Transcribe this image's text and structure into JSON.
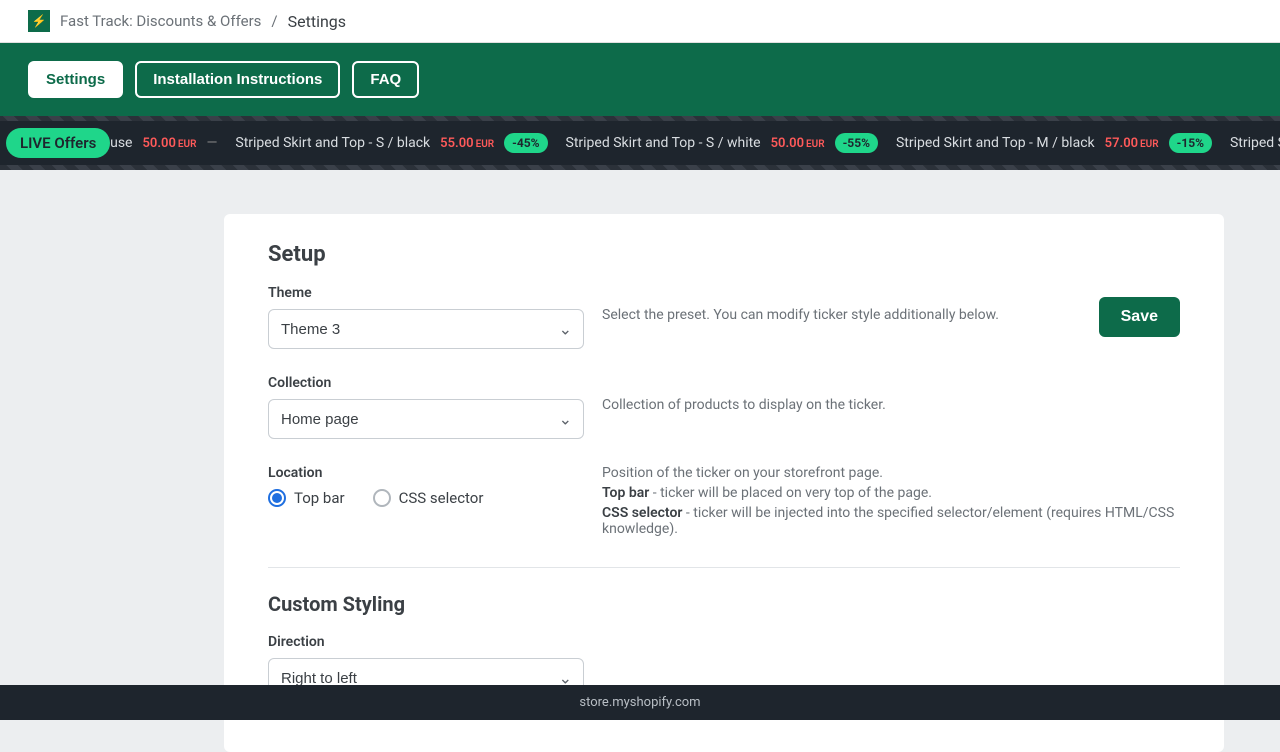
{
  "breadcrumb": {
    "app": "Fast Track: Discounts & Offers",
    "sep": "/",
    "current": "Settings"
  },
  "tabs": {
    "settings": "Settings",
    "install": "Installation Instructions",
    "faq": "FAQ"
  },
  "ticker": {
    "live": "LIVE Offers",
    "items": [
      {
        "name": "Blouse",
        "price": "50.00",
        "cur": "EUR",
        "discount": ""
      },
      {
        "name": "Striped Skirt and Top - S / black",
        "price": "55.00",
        "cur": "EUR",
        "discount": "-45%"
      },
      {
        "name": "Striped Skirt and Top - S / white",
        "price": "50.00",
        "cur": "EUR",
        "discount": "-55%"
      },
      {
        "name": "Striped Skirt and Top - M / black",
        "price": "57.00",
        "cur": "EUR",
        "discount": "-15%"
      },
      {
        "name": "Striped Skirt and Top - M /",
        "price": "",
        "cur": "",
        "discount": ""
      }
    ]
  },
  "setup": {
    "title": "Setup",
    "theme_label": "Theme",
    "theme_value": "Theme 3",
    "theme_help": "Select the preset. You can modify ticker style additionally below.",
    "save": "Save",
    "collection_label": "Collection",
    "collection_value": "Home page",
    "collection_help": "Collection of products to display on the ticker.",
    "location_label": "Location",
    "location_opt1": "Top bar",
    "location_opt2": "CSS selector",
    "location_help1": "Position of the ticker on your storefront page.",
    "location_help2a": "Top bar",
    "location_help2b": " - ticker will be placed on very top of the page.",
    "location_help3a": "CSS selector",
    "location_help3b": " - ticker will be injected into the specified selector/element (requires HTML/CSS knowledge)."
  },
  "custom": {
    "title": "Custom Styling",
    "direction_label": "Direction",
    "direction_value": "Right to left"
  },
  "footer": {
    "domain": "store.myshopify.com"
  }
}
